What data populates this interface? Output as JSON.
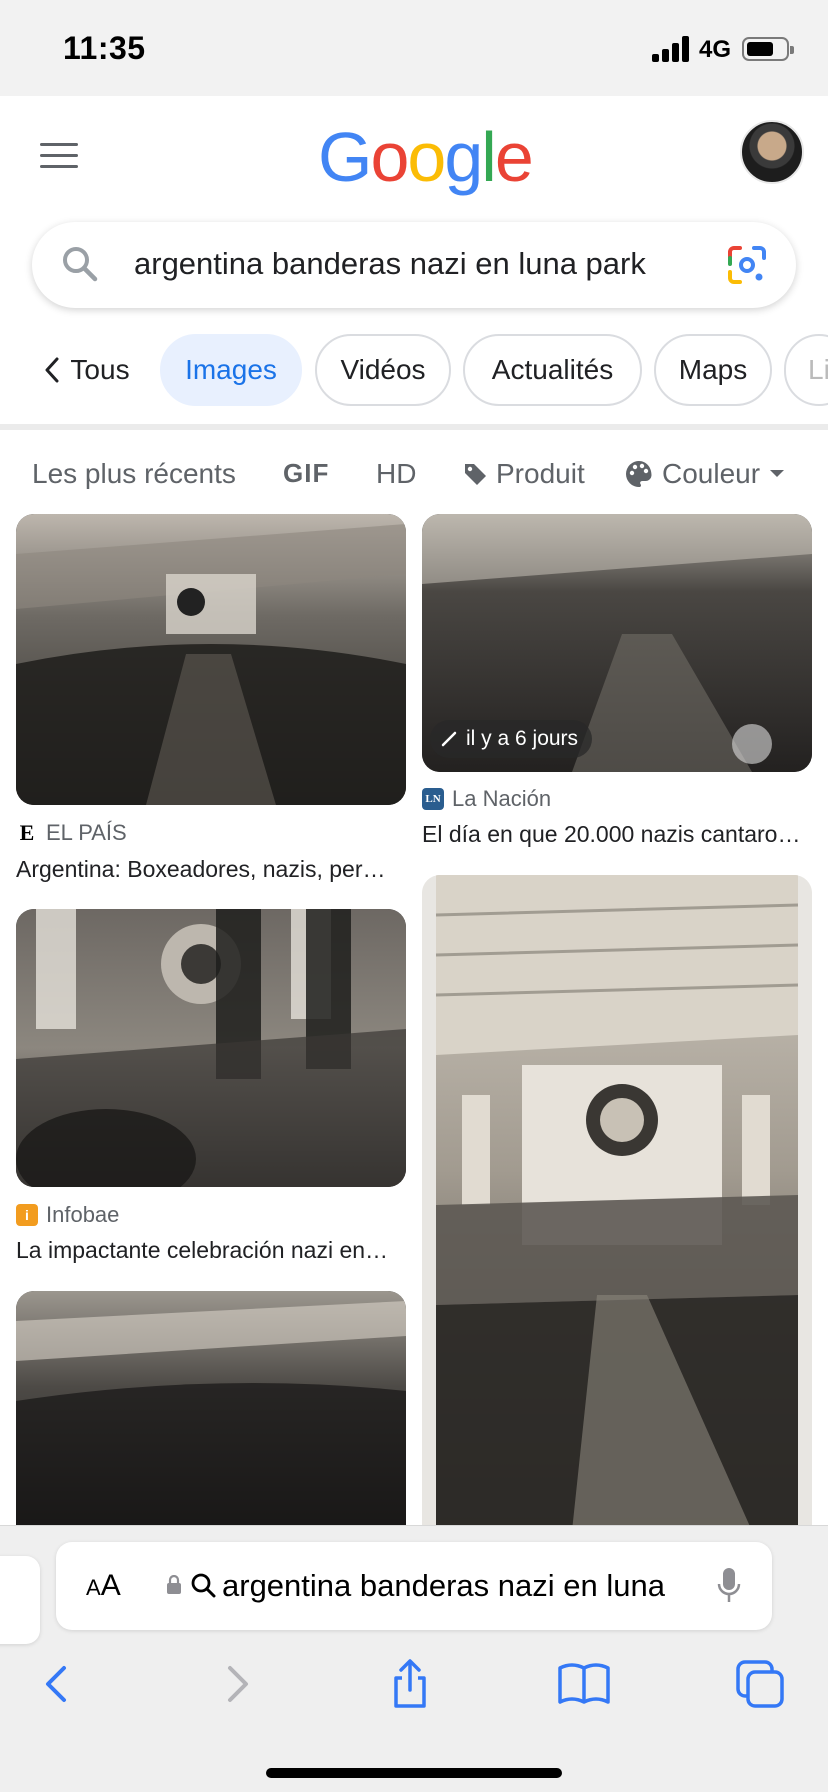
{
  "status_bar": {
    "time": "11:35",
    "network": "4G"
  },
  "header": {
    "logo": "Google"
  },
  "search": {
    "query": "argentina banderas nazi en luna park"
  },
  "tabs": [
    {
      "label": "Tous"
    },
    {
      "label": "Images"
    },
    {
      "label": "Vidéos"
    },
    {
      "label": "Actualités"
    },
    {
      "label": "Maps"
    },
    {
      "label": "Li"
    }
  ],
  "filters": {
    "recent": "Les plus récents",
    "gif": "GIF",
    "hd": "HD",
    "product": "Produit",
    "color": "Couleur"
  },
  "results": [
    {
      "source": "EL PAÍS",
      "title": "Argentina: Boxeadores, nazis, per…"
    },
    {
      "source": "La Nación",
      "title": "El día en que 20.000 nazis cantaro…",
      "badge": "il y a 6 jours"
    },
    {
      "source": "Infobae",
      "title": "La impactante celebración nazi en…"
    },
    {
      "source": "",
      "title": ""
    },
    {
      "source": "",
      "title": ""
    }
  ],
  "safari": {
    "text_size_label": "AA",
    "url": "argentina banderas nazi en luna"
  },
  "colors": {
    "google_blue": "#4285F4",
    "google_red": "#EA4335",
    "google_yellow": "#FBBC05",
    "google_green": "#34A853",
    "active_tab_bg": "#e8f0fe",
    "active_tab_text": "#1a73e8",
    "safari_blue": "#3478f6"
  }
}
